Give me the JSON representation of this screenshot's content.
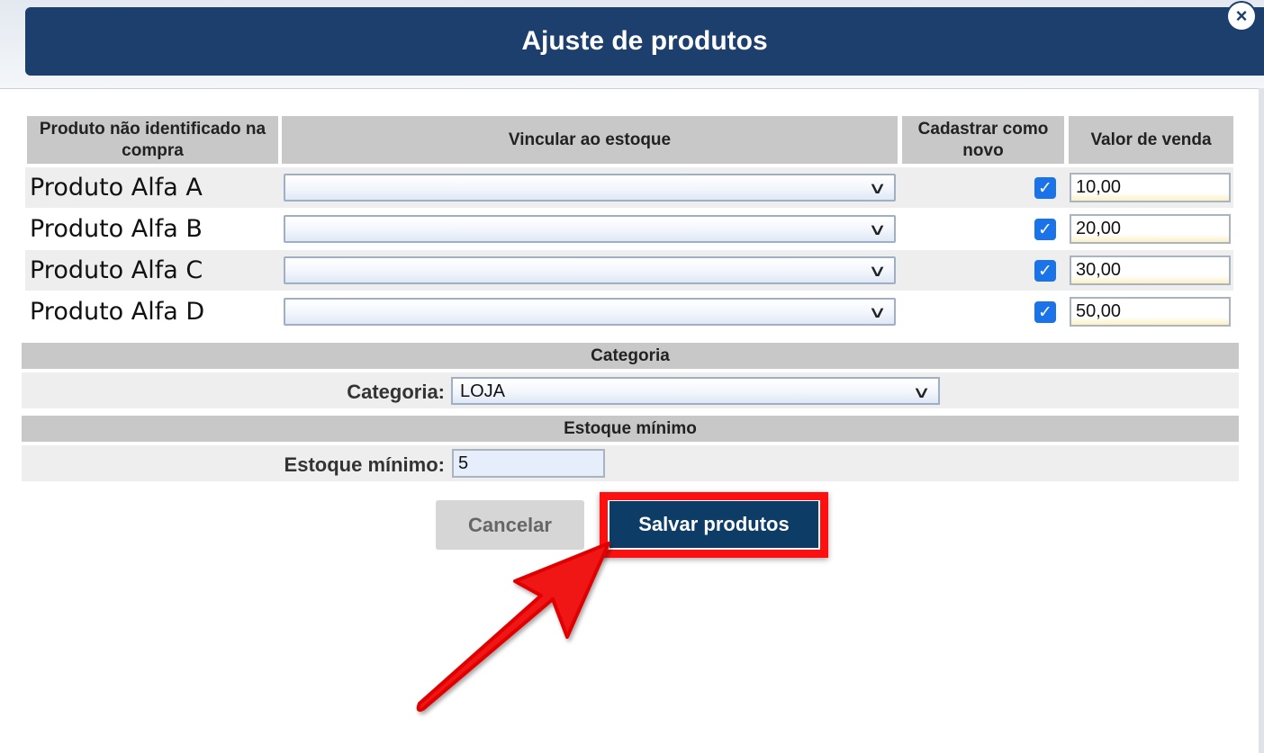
{
  "modal": {
    "title": "Ajuste de produtos",
    "close_symbol": "×"
  },
  "table": {
    "headers": [
      "Produto não identificado na compra",
      "Vincular ao estoque",
      "Cadastrar como novo",
      "Valor de venda"
    ],
    "rows": [
      {
        "name": "Produto Alfa A",
        "stock_link": "",
        "new": true,
        "price": "10,00"
      },
      {
        "name": "Produto Alfa B",
        "stock_link": "",
        "new": true,
        "price": "20,00"
      },
      {
        "name": "Produto Alfa C",
        "stock_link": "",
        "new": true,
        "price": "30,00"
      },
      {
        "name": "Produto Alfa D",
        "stock_link": "",
        "new": true,
        "price": "50,00"
      }
    ]
  },
  "categoria": {
    "section_title": "Categoria",
    "label": "Categoria:",
    "value": "LOJA"
  },
  "estoque": {
    "section_title": "Estoque mínimo",
    "label": "Estoque mínimo:",
    "value": "5"
  },
  "buttons": {
    "cancel": "Cancelar",
    "save": "Salvar produtos"
  },
  "colors": {
    "header_bg": "#1c3f6e",
    "save_bg": "#0d3d67",
    "highlight": "#ff1010",
    "checkbox": "#1a73e8"
  },
  "icons": {
    "close": "close-icon",
    "dropdown": "chevron-down-icon",
    "checkbox": "checkmark-icon",
    "annotation": "arrow-annotation"
  }
}
